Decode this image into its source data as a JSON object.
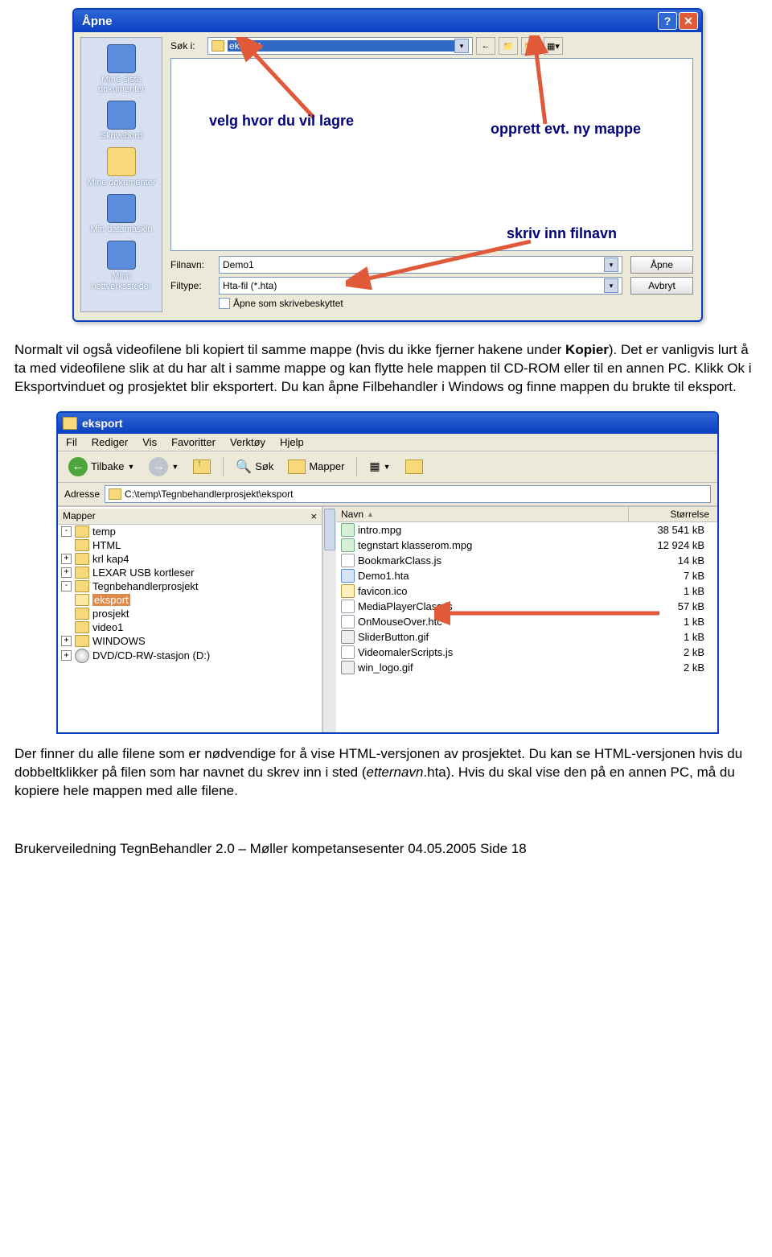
{
  "open_dialog": {
    "title": "Åpne",
    "look_in_label": "Søk i:",
    "look_in_value": "eksport",
    "places": [
      "Mine siste dokumenter",
      "Skrivebord",
      "Mine dokumenter",
      "Min datamaskin",
      "Mine nettverkssteder"
    ],
    "filename_label": "Filnavn:",
    "filename_value": "Demo1",
    "filetype_label": "Filtype:",
    "filetype_value": "Hta-fil (*.hta)",
    "readonly_label": "Åpne som skrivebeskyttet",
    "open_btn": "Åpne",
    "cancel_btn": "Avbryt",
    "annotations": {
      "a1": "velg hvor du vil lagre",
      "a2": "opprett evt. ny mappe",
      "a3": "skriv inn filnavn"
    }
  },
  "para1": "Normalt vil også videofilene bli kopiert til samme mappe (hvis du ikke fjerner hakene under Kopier). Det er vanligvis lurt å ta med videofilene slik at du har alt i samme mappe og kan flytte hele mappen til CD-ROM eller til en annen PC. Klikk Ok i Eksportvinduet og prosjektet blir eksportert. Du kan åpne Filbehandler i Windows og finne mappen du brukte til eksport.",
  "para1_bold": "Kopier",
  "explorer": {
    "title": "eksport",
    "menu": [
      "Fil",
      "Rediger",
      "Vis",
      "Favoritter",
      "Verktøy",
      "Hjelp"
    ],
    "toolbar": {
      "back": "Tilbake",
      "search": "Søk",
      "folders": "Mapper"
    },
    "address_label": "Adresse",
    "address_value": "C:\\temp\\Tegnbehandlerprosjekt\\eksport",
    "tree_head": "Mapper",
    "tree": [
      {
        "level": 0,
        "exp": "-",
        "type": "fold",
        "label": "temp"
      },
      {
        "level": 1,
        "exp": "",
        "type": "fold",
        "label": "HTML"
      },
      {
        "level": 1,
        "exp": "+",
        "type": "fold",
        "label": "krl kap4"
      },
      {
        "level": 1,
        "exp": "+",
        "type": "fold",
        "label": "LEXAR USB kortleser"
      },
      {
        "level": 1,
        "exp": "-",
        "type": "fold",
        "label": "Tegnbehandlerprosjekt"
      },
      {
        "level": 2,
        "exp": "",
        "type": "fold",
        "label": "eksport",
        "selected": true
      },
      {
        "level": 2,
        "exp": "",
        "type": "fold",
        "label": "prosjekt"
      },
      {
        "level": 2,
        "exp": "",
        "type": "fold",
        "label": "video1"
      },
      {
        "level": 1,
        "exp": "+",
        "type": "fold",
        "label": "WINDOWS"
      },
      {
        "level": 0,
        "exp": "+",
        "type": "cd",
        "label": "DVD/CD-RW-stasjon (D:)"
      }
    ],
    "file_columns": {
      "name": "Navn",
      "size": "Størrelse"
    },
    "files": [
      {
        "icon": "mpg",
        "name": "intro.mpg",
        "size": "38 541 kB"
      },
      {
        "icon": "mpg",
        "name": "tegnstart klasserom.mpg",
        "size": "12 924 kB"
      },
      {
        "icon": "js",
        "name": "BookmarkClass.js",
        "size": "14 kB"
      },
      {
        "icon": "hta",
        "name": "Demo1.hta",
        "size": "7 kB"
      },
      {
        "icon": "ico",
        "name": "favicon.ico",
        "size": "1 kB"
      },
      {
        "icon": "js",
        "name": "MediaPlayerClass.js",
        "size": "57 kB"
      },
      {
        "icon": "js",
        "name": "OnMouseOver.htc",
        "size": "1 kB"
      },
      {
        "icon": "gif",
        "name": "SliderButton.gif",
        "size": "1 kB"
      },
      {
        "icon": "js",
        "name": "VideomalerScripts.js",
        "size": "2 kB"
      },
      {
        "icon": "gif",
        "name": "win_logo.gif",
        "size": "2 kB"
      }
    ]
  },
  "para2_a": "Der finner du alle filene som er nødvendige for å vise HTML-versjonen av prosjektet. Du kan se HTML-versjonen hvis du dobbeltklikker på filen som har navnet du skrev inn i sted (",
  "para2_b": "etternavn",
  "para2_c": ".hta). Hvis du skal vise den på en annen PC, må du kopiere hele mappen med alle filene.",
  "footer": "Brukerveiledning TegnBehandler 2.0 – Møller kompetansesenter 04.05.2005   Side 18"
}
